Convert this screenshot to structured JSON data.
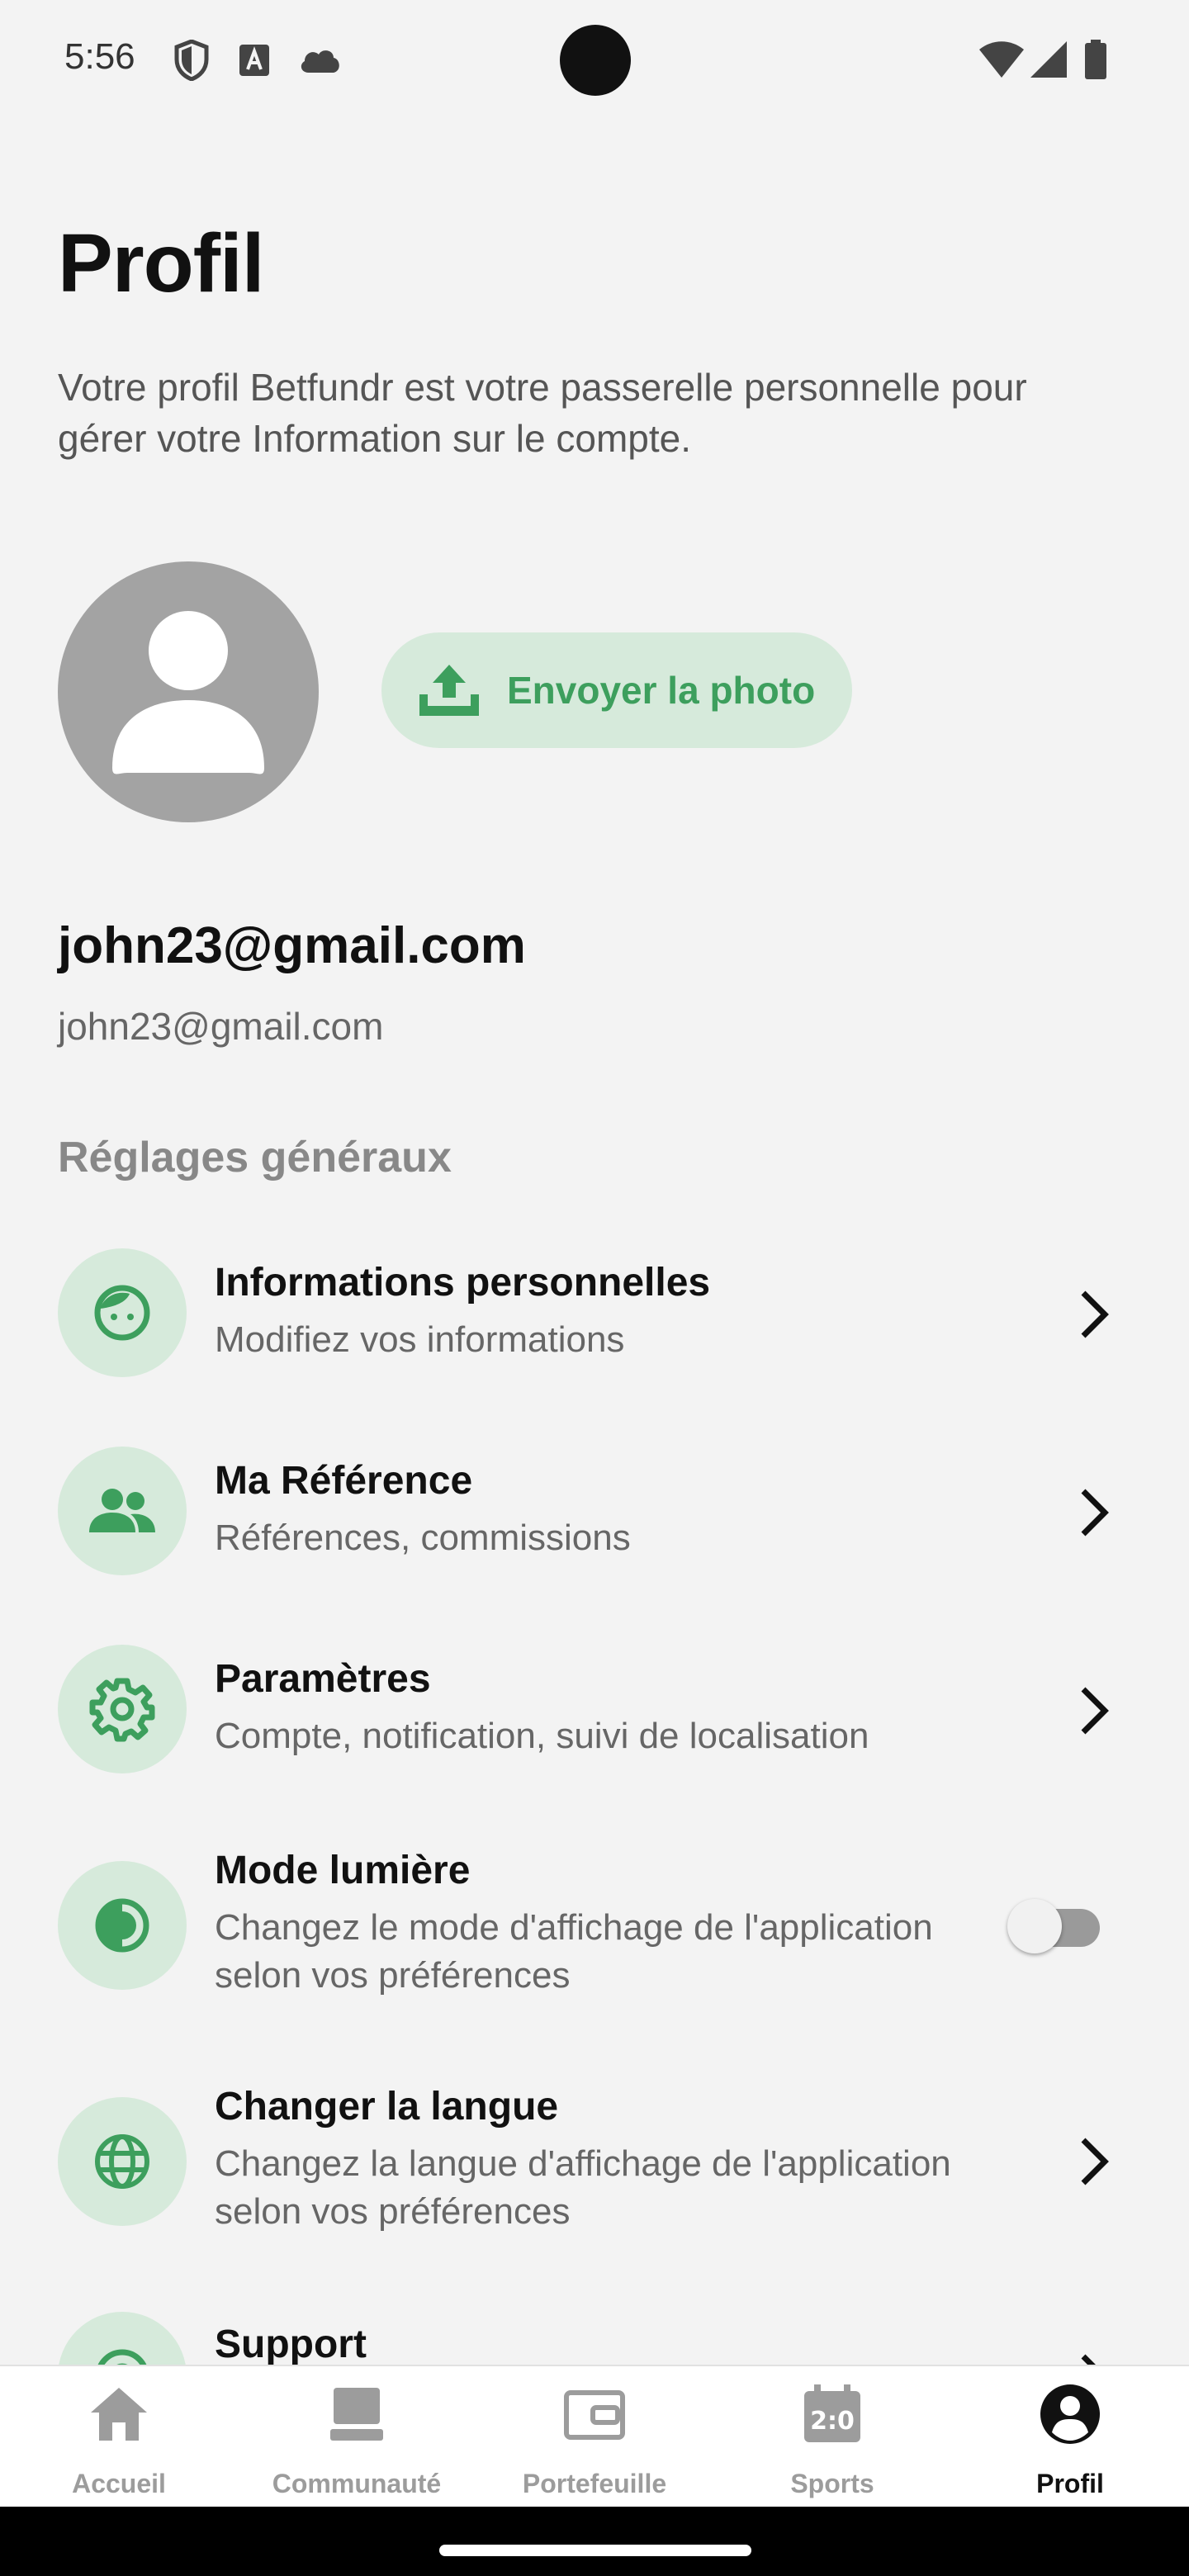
{
  "status_bar": {
    "time": "5:56"
  },
  "header": {
    "title": "Profil",
    "description": "Votre profil Betfundr est votre passerelle personnelle pour gérer votre Information sur le compte."
  },
  "avatar": {
    "upload_label": "Envoyer la photo"
  },
  "account": {
    "email_title": "john23@gmail.com",
    "email_subtitle": "john23@gmail.com"
  },
  "section_title": "Réglages généraux",
  "items": [
    {
      "title": "Informations personnelles",
      "subtitle": "Modifiez vos informations",
      "icon": "face-icon"
    },
    {
      "title": "Ma Référence",
      "subtitle": "Références, commissions",
      "icon": "people-icon"
    },
    {
      "title": "Paramètres",
      "subtitle": "Compte, notification, suivi de localisation",
      "icon": "gear-icon"
    },
    {
      "title": "Mode lumière",
      "subtitle": "Changez le mode d'affichage de l'application selon vos préférences",
      "icon": "contrast-icon",
      "toggle_on": false
    },
    {
      "title": "Changer la langue",
      "subtitle": "Changez la langue d'affichage de l'application selon vos préférences",
      "icon": "globe-icon"
    },
    {
      "title": "Support",
      "icon": "support-icon"
    }
  ],
  "bottom_nav": [
    {
      "label": "Accueil",
      "icon": "home-icon"
    },
    {
      "label": "Communauté",
      "icon": "community-icon"
    },
    {
      "label": "Portefeuille",
      "icon": "wallet-icon"
    },
    {
      "label": "Sports",
      "icon": "scoreboard-icon"
    },
    {
      "label": "Profil",
      "icon": "profile-icon",
      "active": true
    }
  ],
  "colors": {
    "accent": "#3d9f5d",
    "accent_light": "#d6eadb",
    "background": "#f3f3f3"
  }
}
